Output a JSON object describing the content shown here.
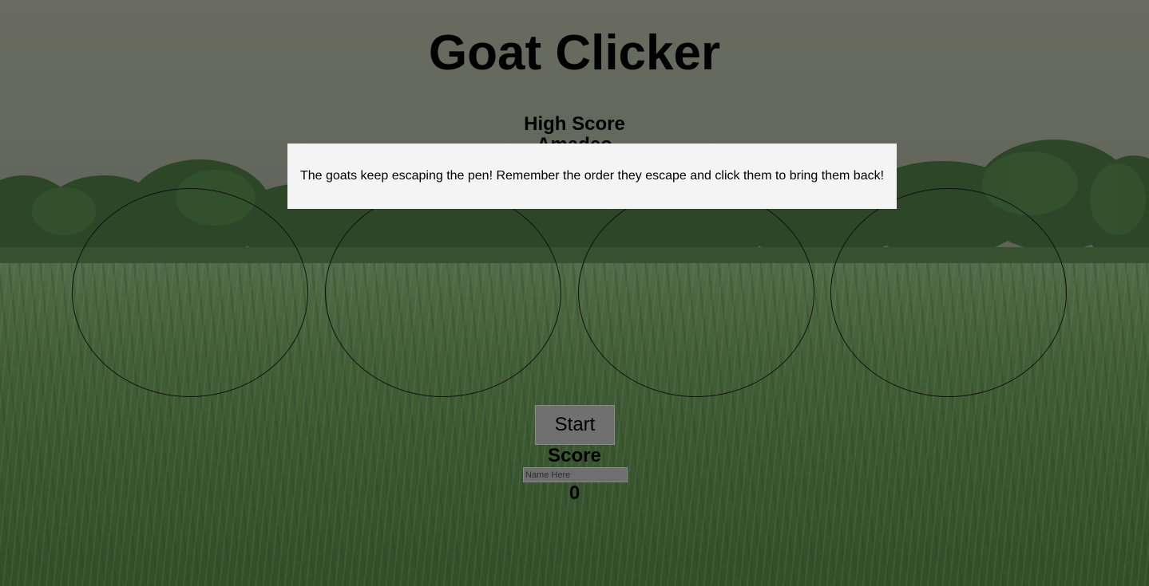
{
  "game": {
    "title": "Goat Clicker",
    "high_score_label": "High Score",
    "high_score_name": "Amadeo",
    "instructions": "The goats keep escaping the pen! Remember the order they escape and click them to bring them back!",
    "start_label": "Start",
    "score_label": "Score",
    "name_placeholder": "Name Here",
    "score_value": "0",
    "pens": [
      "pen-1",
      "pen-2",
      "pen-3",
      "pen-4"
    ]
  }
}
